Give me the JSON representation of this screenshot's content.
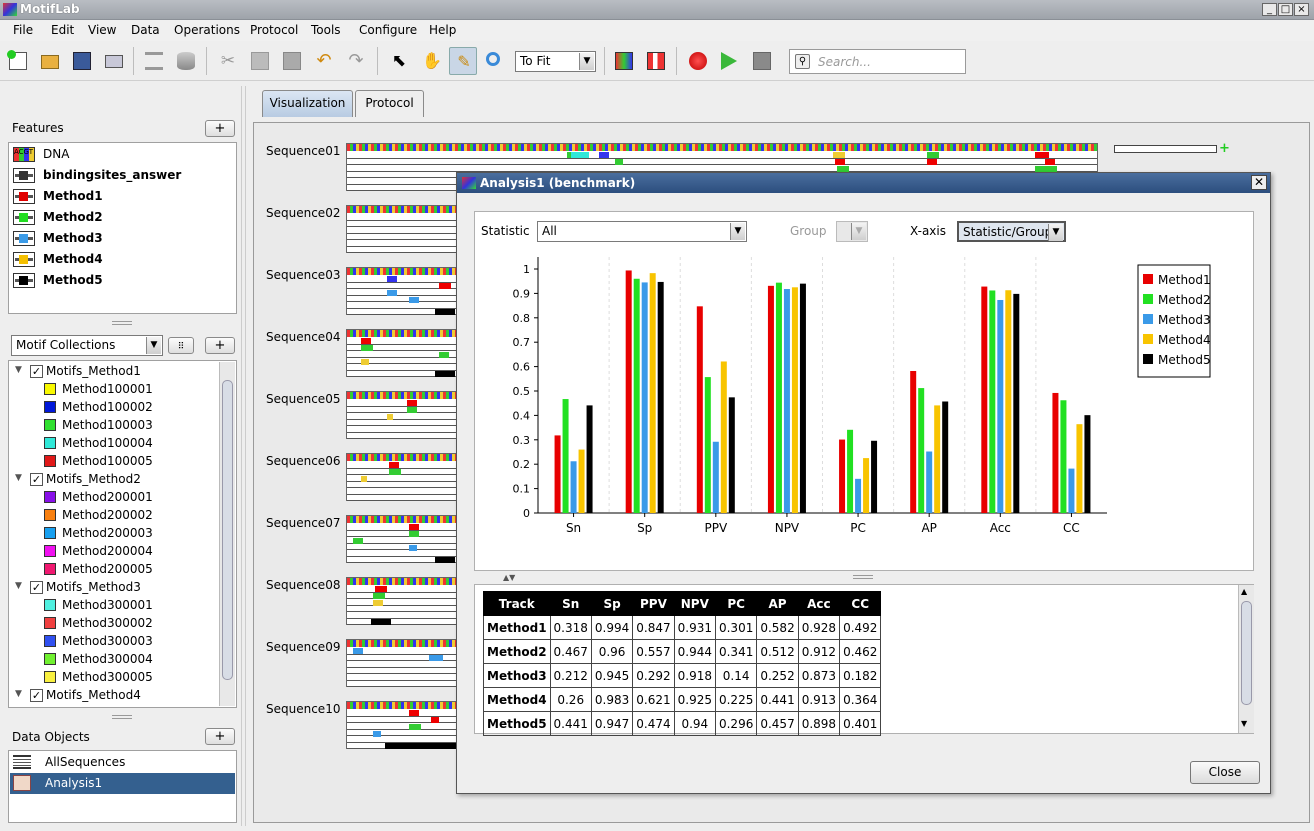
{
  "app": {
    "title": "MotifLab"
  },
  "menu": [
    "File",
    "Edit",
    "View",
    "Data",
    "Operations",
    "Protocol",
    "Tools",
    "Configure",
    "Help"
  ],
  "toolbar": {
    "zoom": "To Fit",
    "search_placeholder": "Search..."
  },
  "features": {
    "header": "Features",
    "items": [
      {
        "label": "DNA",
        "icon": "dna-track-icon",
        "bold": false
      },
      {
        "label": "bindingsites_answer",
        "icon": "region-track-icon",
        "color": "#333333"
      },
      {
        "label": "Method1",
        "icon": "region-track-icon",
        "color": "#e00000"
      },
      {
        "label": "Method2",
        "icon": "region-track-icon",
        "color": "#22dd22"
      },
      {
        "label": "Method3",
        "icon": "region-track-icon",
        "color": "#3b9be8"
      },
      {
        "label": "Method4",
        "icon": "region-track-icon",
        "color": "#f5c000"
      },
      {
        "label": "Method5",
        "icon": "region-track-icon",
        "color": "#000000"
      }
    ]
  },
  "motif_collections": {
    "selector": "Motif Collections",
    "groups": [
      {
        "name": "Motifs_Method1",
        "motifs": [
          {
            "name": "Method100001",
            "color": "#f8f800"
          },
          {
            "name": "Method100002",
            "color": "#0018d8"
          },
          {
            "name": "Method100003",
            "color": "#30e030"
          },
          {
            "name": "Method100004",
            "color": "#30e8d8"
          },
          {
            "name": "Method100005",
            "color": "#e01818"
          }
        ]
      },
      {
        "name": "Motifs_Method2",
        "motifs": [
          {
            "name": "Method200001",
            "color": "#8810e8"
          },
          {
            "name": "Method200002",
            "color": "#f88010"
          },
          {
            "name": "Method200003",
            "color": "#18a0f0"
          },
          {
            "name": "Method200004",
            "color": "#f010f0"
          },
          {
            "name": "Method200005",
            "color": "#f01870"
          }
        ]
      },
      {
        "name": "Motifs_Method3",
        "motifs": [
          {
            "name": "Method300001",
            "color": "#50f0e0"
          },
          {
            "name": "Method300002",
            "color": "#f04040"
          },
          {
            "name": "Method300003",
            "color": "#3050f0"
          },
          {
            "name": "Method300004",
            "color": "#70f030"
          },
          {
            "name": "Method300005",
            "color": "#f8f040"
          }
        ]
      },
      {
        "name": "Motifs_Method4",
        "motifs": []
      }
    ]
  },
  "data_objects": {
    "header": "Data Objects",
    "items": [
      {
        "label": "AllSequences",
        "selected": false
      },
      {
        "label": "Analysis1",
        "selected": true
      }
    ]
  },
  "tabs": [
    "Visualization",
    "Protocol"
  ],
  "sequences": [
    "Sequence01",
    "Sequence02",
    "Sequence03",
    "Sequence04",
    "Sequence05",
    "Sequence06",
    "Sequence07",
    "Sequence08",
    "Sequence09",
    "Sequence10"
  ],
  "dialog": {
    "title": "Analysis1  (benchmark)",
    "statistic_label": "Statistic",
    "statistic_value": "All",
    "group_label": "Group",
    "xaxis_label": "X-axis",
    "xaxis_value": "Statistic/Group",
    "close_label": "Close"
  },
  "chart_data": {
    "type": "bar",
    "categories": [
      "Sn",
      "Sp",
      "PPV",
      "NPV",
      "PC",
      "AP",
      "Acc",
      "CC"
    ],
    "ylim": [
      0,
      1
    ],
    "yticks": [
      "0",
      "0.1",
      "0.2",
      "0.3",
      "0.4",
      "0.5",
      "0.6",
      "0.7",
      "0.8",
      "0.9",
      "1"
    ],
    "legend_position": "right",
    "series": [
      {
        "name": "Method1",
        "color": "#e80000",
        "values": [
          0.318,
          0.994,
          0.847,
          0.931,
          0.301,
          0.582,
          0.928,
          0.492
        ]
      },
      {
        "name": "Method2",
        "color": "#22e022",
        "values": [
          0.467,
          0.96,
          0.557,
          0.944,
          0.341,
          0.512,
          0.912,
          0.462
        ]
      },
      {
        "name": "Method3",
        "color": "#3a9ae8",
        "values": [
          0.212,
          0.945,
          0.292,
          0.918,
          0.14,
          0.252,
          0.873,
          0.182
        ]
      },
      {
        "name": "Method4",
        "color": "#f8c400",
        "values": [
          0.26,
          0.983,
          0.621,
          0.925,
          0.225,
          0.441,
          0.913,
          0.364
        ]
      },
      {
        "name": "Method5",
        "color": "#000000",
        "values": [
          0.441,
          0.947,
          0.474,
          0.94,
          0.296,
          0.457,
          0.898,
          0.401
        ]
      }
    ]
  },
  "results_table": {
    "headers": [
      "Track",
      "Sn",
      "Sp",
      "PPV",
      "NPV",
      "PC",
      "AP",
      "Acc",
      "CC"
    ],
    "rows": [
      [
        "Method1",
        "0.318",
        "0.994",
        "0.847",
        "0.931",
        "0.301",
        "0.582",
        "0.928",
        "0.492"
      ],
      [
        "Method2",
        "0.467",
        "0.96",
        "0.557",
        "0.944",
        "0.341",
        "0.512",
        "0.912",
        "0.462"
      ],
      [
        "Method3",
        "0.212",
        "0.945",
        "0.292",
        "0.918",
        "0.14",
        "0.252",
        "0.873",
        "0.182"
      ],
      [
        "Method4",
        "0.26",
        "0.983",
        "0.621",
        "0.925",
        "0.225",
        "0.441",
        "0.913",
        "0.364"
      ],
      [
        "Method5",
        "0.441",
        "0.947",
        "0.474",
        "0.94",
        "0.296",
        "0.457",
        "0.898",
        "0.401"
      ]
    ]
  }
}
